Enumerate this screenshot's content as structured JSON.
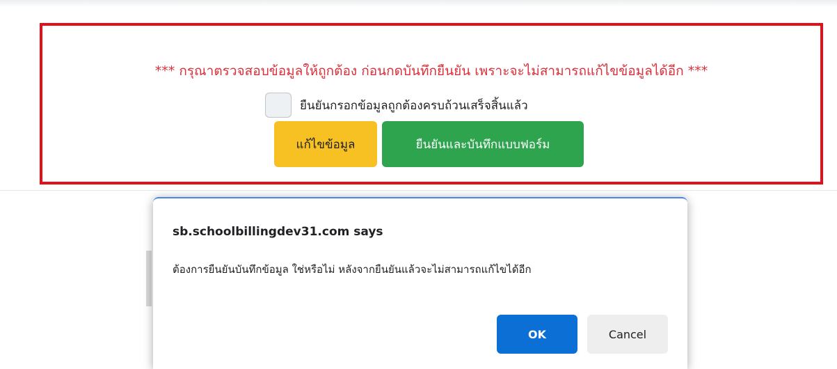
{
  "form": {
    "warning": "*** กรุณาตรวจสอบข้อมูลให้ถูกต้อง ก่อนกดบันทึกยืนยัน เพราะจะไม่สามารถแก้ไขข้อมูลได้อีก ***",
    "confirm_checkbox_label": "ยืนยันกรอกข้อมูลถูกต้องครบถ้วนเสร็จสิ้นแล้ว",
    "confirm_checked": false,
    "edit_button_label": "แก้ไขข้อมูล",
    "save_button_label": "ยืนยันและบันทึกแบบฟอร์ม"
  },
  "dialog": {
    "title": "sb.schoolbillingdev31.com says",
    "message": "ต้องการยืนยันบันทึกข้อมูล ใช่หรือไม่ หลังจากยืนยันแล้วจะไม่สามารถแก้ไขได้อีก",
    "ok_label": "OK",
    "cancel_label": "Cancel"
  },
  "colors": {
    "highlight_border": "#e3101c",
    "warning_text": "#d9303a",
    "edit_button": "#f7c023",
    "save_button": "#2ea44f",
    "ok_button": "#0b6fd6",
    "cancel_button": "#eeeeee"
  }
}
